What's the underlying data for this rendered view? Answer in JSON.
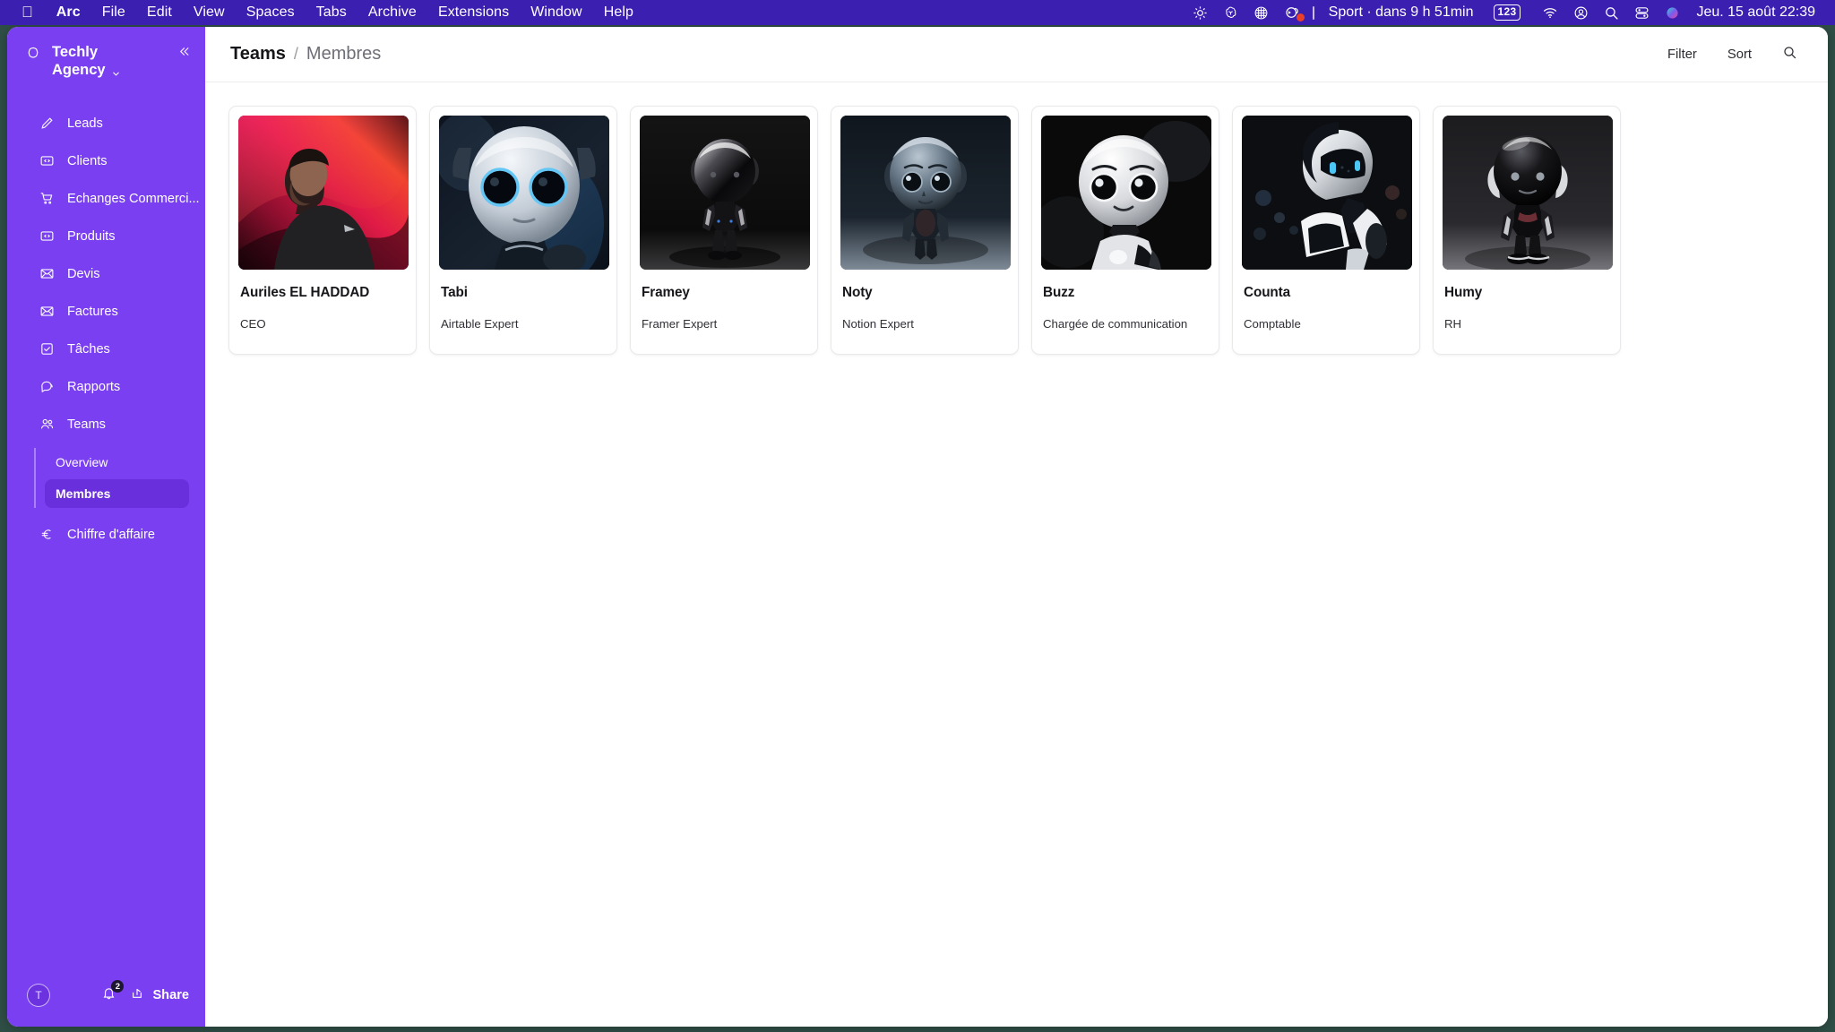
{
  "menubar": {
    "apple_icon": "apple-logo-icon",
    "items": [
      {
        "label": "Arc",
        "bold": true
      },
      {
        "label": "File",
        "bold": false
      },
      {
        "label": "Edit",
        "bold": false
      },
      {
        "label": "View",
        "bold": false
      },
      {
        "label": "Spaces",
        "bold": false
      },
      {
        "label": "Tabs",
        "bold": false
      },
      {
        "label": "Archive",
        "bold": false
      },
      {
        "label": "Extensions",
        "bold": false
      },
      {
        "label": "Window",
        "bold": false
      },
      {
        "label": "Help",
        "bold": false
      }
    ],
    "status": {
      "sport_text": "Sport · dans 9 h 51min",
      "input_badge": "123",
      "clock": "Jeu. 15 août  22:39",
      "icons": [
        "sun-brightness-icon",
        "openai-icon",
        "grid-apps-icon",
        "camera-record-icon",
        "wifi-icon",
        "account-circle-icon",
        "search-icon",
        "control-center-icon",
        "siri-icon"
      ]
    },
    "colors": {
      "background": "#3b1fb0",
      "text": "#ffffff"
    }
  },
  "sidebar": {
    "brand": {
      "line1": "Techly",
      "line2": "Agency",
      "logo_icon": "hexagon-flower-logo-icon",
      "chevron_icon": "chevron-down-icon"
    },
    "collapse_icon": "double-chevron-left-icon",
    "items": [
      {
        "label": "Leads",
        "icon": "pencil-icon"
      },
      {
        "label": "Clients",
        "icon": "code-box-icon"
      },
      {
        "label": "Echanges Commerci...",
        "icon": "shopping-cart-icon"
      },
      {
        "label": "Produits",
        "icon": "code-box-icon"
      },
      {
        "label": "Devis",
        "icon": "envelope-icon"
      },
      {
        "label": "Factures",
        "icon": "envelope-icon"
      },
      {
        "label": "Tâches",
        "icon": "checkbox-icon"
      },
      {
        "label": "Rapports",
        "icon": "chat-bubble-icon"
      },
      {
        "label": "Teams",
        "icon": "people-icon"
      }
    ],
    "subitems": [
      {
        "label": "Overview",
        "active": false
      },
      {
        "label": "Membres",
        "active": true
      }
    ],
    "last_item": {
      "label": "Chiffre d'affaire",
      "icon": "euro-icon"
    },
    "footer": {
      "avatar_initial": "T",
      "bell_icon": "bell-icon",
      "bell_badge": "2",
      "share_icon": "share-arrow-icon",
      "share_label": "Share"
    },
    "colors": {
      "background": "#7a3ff0",
      "active_pill": "#6a2fdc",
      "text": "#ffffff"
    }
  },
  "topbar": {
    "breadcrumb_parent": "Teams",
    "breadcrumb_sep": "/",
    "breadcrumb_current": "Membres",
    "filter_label": "Filter",
    "sort_label": "Sort",
    "search_icon": "search-icon"
  },
  "members": [
    {
      "name": "Auriles EL HADDAD",
      "role": "CEO",
      "avatar": "photo-man-red-gradient"
    },
    {
      "name": "Tabi",
      "role": "Airtable Expert",
      "avatar": "white-robot-blue-eyes"
    },
    {
      "name": "Framey",
      "role": "Framer Expert",
      "avatar": "black-glossy-robot"
    },
    {
      "name": "Noty",
      "role": "Notion Expert",
      "avatar": "bluegray-robot"
    },
    {
      "name": "Buzz",
      "role": "Chargée de communication",
      "avatar": "white-robot-dark-bg"
    },
    {
      "name": "Counta",
      "role": "Comptable",
      "avatar": "white-black-robot-city"
    },
    {
      "name": "Humy",
      "role": "RH",
      "avatar": "black-silver-robot"
    }
  ]
}
